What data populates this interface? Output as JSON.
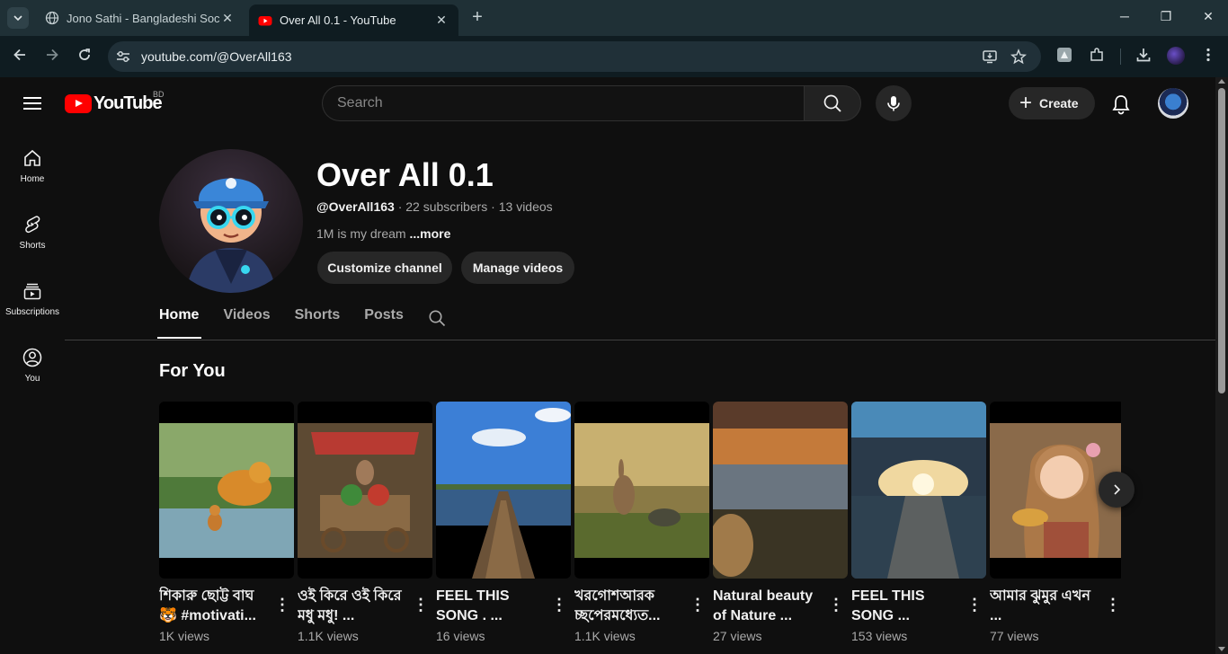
{
  "browser": {
    "tabs": [
      {
        "title": "Jono Sathi - Bangladeshi Social",
        "active": false
      },
      {
        "title": "Over All 0.1 - YouTube",
        "active": true
      }
    ],
    "url": "youtube.com/@OverAll163",
    "new_tab_label": "+",
    "minimize_label": "─",
    "restore_label": "❐",
    "close_label": "✕"
  },
  "masthead": {
    "logo_text": "YouTube",
    "country_code": "BD",
    "search_placeholder": "Search",
    "create_label": "Create"
  },
  "guide": {
    "items": [
      {
        "label": "Home",
        "icon": "home-icon"
      },
      {
        "label": "Shorts",
        "icon": "shorts-icon"
      },
      {
        "label": "Subscriptions",
        "icon": "subscriptions-icon"
      },
      {
        "label": "You",
        "icon": "you-icon"
      }
    ]
  },
  "channel": {
    "name": "Over All 0.1",
    "handle": "@OverAll163",
    "stats": " · 22 subscribers · 13 videos",
    "description": "1M is my dream ",
    "more_label": "...more",
    "customize_label": "Customize channel",
    "manage_label": "Manage videos"
  },
  "channel_tabs": [
    "Home",
    "Videos",
    "Shorts",
    "Posts"
  ],
  "section": {
    "title": "For You"
  },
  "shorts": [
    {
      "title": "শিকারু ছোট্ট বাঘ 🐯 #motivati...",
      "views": "1K views"
    },
    {
      "title": "ওই কিরে ওই কিরে মধু মধু! ...",
      "views": "1.1K views"
    },
    {
      "title": "FEEL THIS SONG . ...",
      "views": "16 views"
    },
    {
      "title": "খরগোশআরক চ্ছপেরমধ্যেত...",
      "views": "1.1K views"
    },
    {
      "title": "Natural beauty of Nature ...",
      "views": "27 views"
    },
    {
      "title": "FEEL THIS SONG  ...",
      "views": "153 views"
    },
    {
      "title": "আমার ঝুমুর এখন ...",
      "views": "77 views"
    }
  ],
  "colors": {
    "brand_red": "#ff0000",
    "background": "#0f0f0f",
    "chrome_tabbar": "#1f3036",
    "chrome_toolbar": "#0f1c21"
  }
}
